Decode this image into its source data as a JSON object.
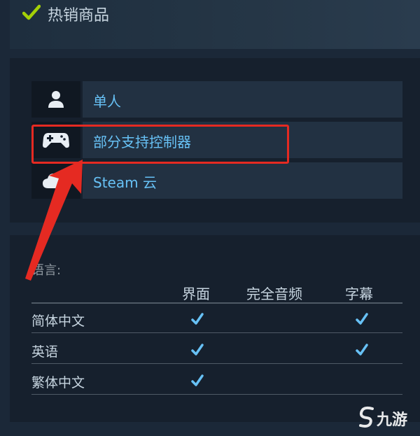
{
  "header": {
    "icon": "check-icon",
    "title": "热销商品"
  },
  "features": [
    {
      "icon": "single-player-icon",
      "label": "单人"
    },
    {
      "icon": "controller-icon",
      "label": "部分支持控制器"
    },
    {
      "icon": "cloud-icon",
      "label": "Steam 云"
    }
  ],
  "languages": {
    "heading": "语言:",
    "columns": [
      "界面",
      "完全音频",
      "字幕"
    ],
    "rows": [
      {
        "name": "简体中文",
        "interface": true,
        "full_audio": false,
        "subtitles": true
      },
      {
        "name": "英语",
        "interface": true,
        "full_audio": false,
        "subtitles": true
      },
      {
        "name": "繁体中文",
        "interface": true,
        "full_audio": false,
        "subtitles": false
      }
    ]
  },
  "watermark": {
    "text": "九游"
  },
  "colors": {
    "background": "#1b2838",
    "link_blue": "#67c1f5",
    "check_green": "#a4d007",
    "check_blue": "#67c1f5",
    "highlight_red": "#e52a22"
  }
}
